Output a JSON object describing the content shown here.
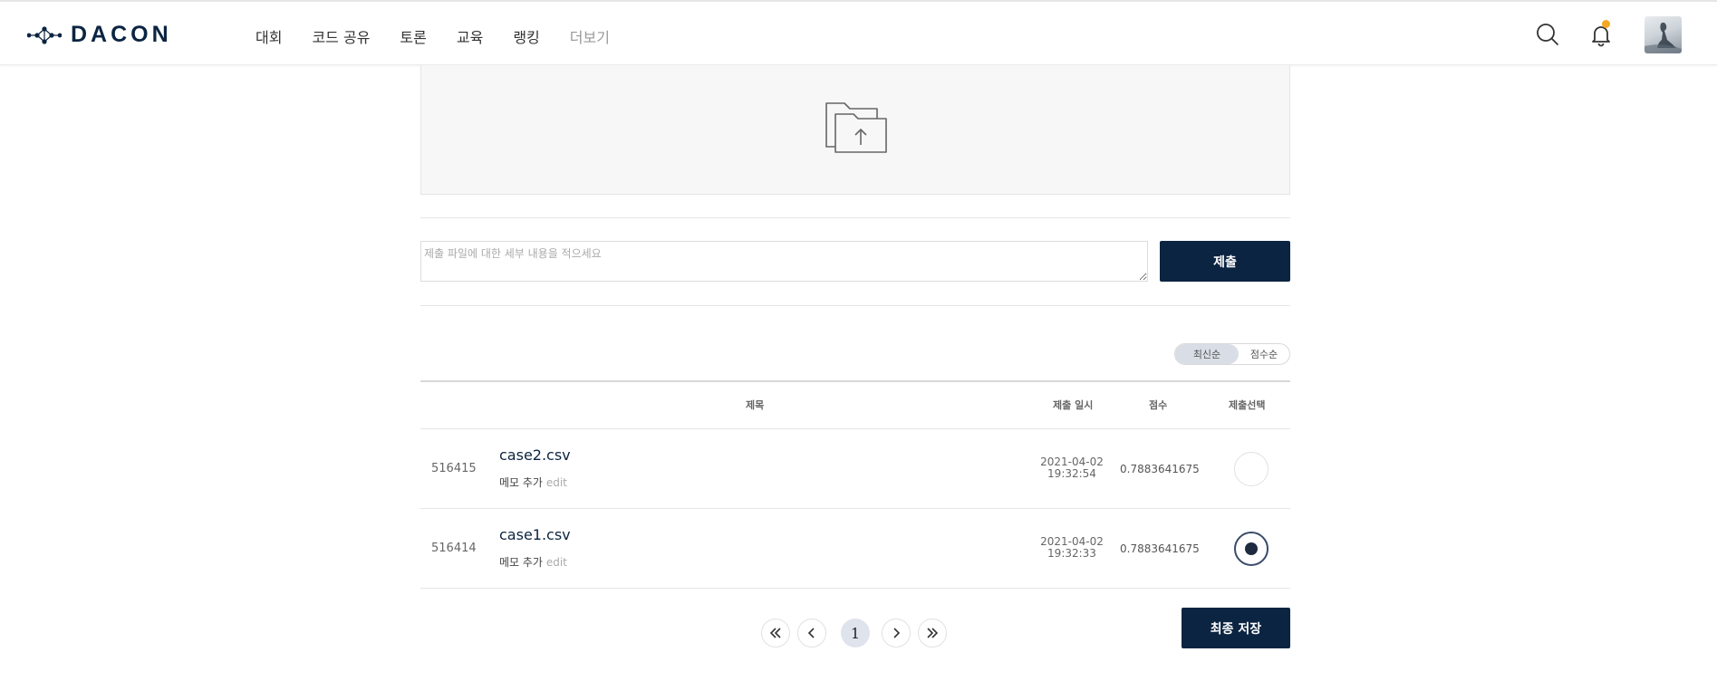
{
  "header": {
    "logo_text": "DACON",
    "nav": [
      {
        "label": "대회"
      },
      {
        "label": "코드 공유"
      },
      {
        "label": "토론"
      },
      {
        "label": "교육"
      },
      {
        "label": "랭킹"
      },
      {
        "label": "더보기"
      }
    ],
    "icons": [
      "search-icon",
      "bell-icon"
    ],
    "notification_dot_color": "#f5a623"
  },
  "upload": {
    "icon": "folder-upload-icon"
  },
  "submit_form": {
    "memo_placeholder": "제출 파일에 대한 세부 내용을 적으세요",
    "submit_label": "제출"
  },
  "sort": {
    "options": [
      "최신순",
      "점수순"
    ],
    "active": "최신순"
  },
  "table": {
    "headers": {
      "title": "제목",
      "date": "제출 일시",
      "score": "점수",
      "select": "제출선택"
    },
    "rows": [
      {
        "id": "516415",
        "title": "case2.csv",
        "memo_label": "메모 추가",
        "edit_label": "edit",
        "date": "2021-04-02",
        "time": "19:32:54",
        "score": "0.7883641675",
        "selected": false
      },
      {
        "id": "516414",
        "title": "case1.csv",
        "memo_label": "메모 추가",
        "edit_label": "edit",
        "date": "2021-04-02",
        "time": "19:32:33",
        "score": "0.7883641675",
        "selected": true
      }
    ]
  },
  "pagination": {
    "current": "1",
    "icons": [
      "first-page-icon",
      "prev-page-icon",
      "next-page-icon",
      "last-page-icon"
    ]
  },
  "final_save_label": "최종 저장",
  "colors": {
    "brand": "#0b2441",
    "accent": "#f5a623"
  }
}
